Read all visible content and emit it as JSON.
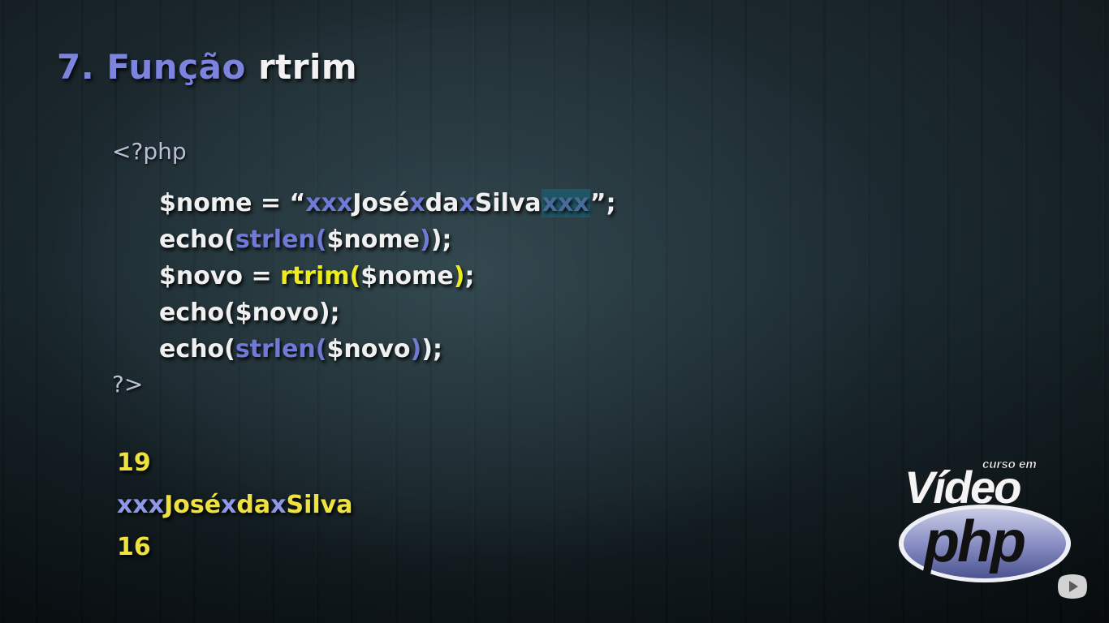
{
  "slide": {
    "title_number": "7.",
    "title_word": "Função",
    "title_function": "rtrim"
  },
  "code": {
    "open_tag": "<?php",
    "close_tag": "?>",
    "line1": {
      "var": "$nome = “",
      "s1": "xxx",
      "s2": "José",
      "s3": "x",
      "s4": "da",
      "s5": "x",
      "s6": "Silva",
      "s7": "xxx",
      "end": "”;"
    },
    "line2": {
      "a": "echo(",
      "fn": "strlen(",
      "arg": "$nome",
      "close_fn": ")",
      "end": ");"
    },
    "line3": {
      "a": "$novo = ",
      "fn": "rtrim(",
      "arg": "$nome",
      "close_fn": ")",
      "end": ";"
    },
    "line4": {
      "a": "echo($novo);"
    },
    "line5": {
      "a": "echo(",
      "fn": "strlen(",
      "arg": "$novo",
      "close_fn": ")",
      "end": ");"
    }
  },
  "output": {
    "len_before": "19",
    "result": {
      "s1": "xxx",
      "s2": "José",
      "s3": "x",
      "s4": "da",
      "s5": "x",
      "s6": "Silva"
    },
    "len_after": "16"
  },
  "logo": {
    "small": "curso em",
    "big": "Vídeo",
    "sub": "php"
  },
  "colors": {
    "title_blue": "#7c84de",
    "code_blue": "#6f7ad6",
    "code_yellow": "#ecec1e",
    "highlight_bg": "#1f5666"
  },
  "icons": {
    "corner": "youtube-play-icon"
  }
}
